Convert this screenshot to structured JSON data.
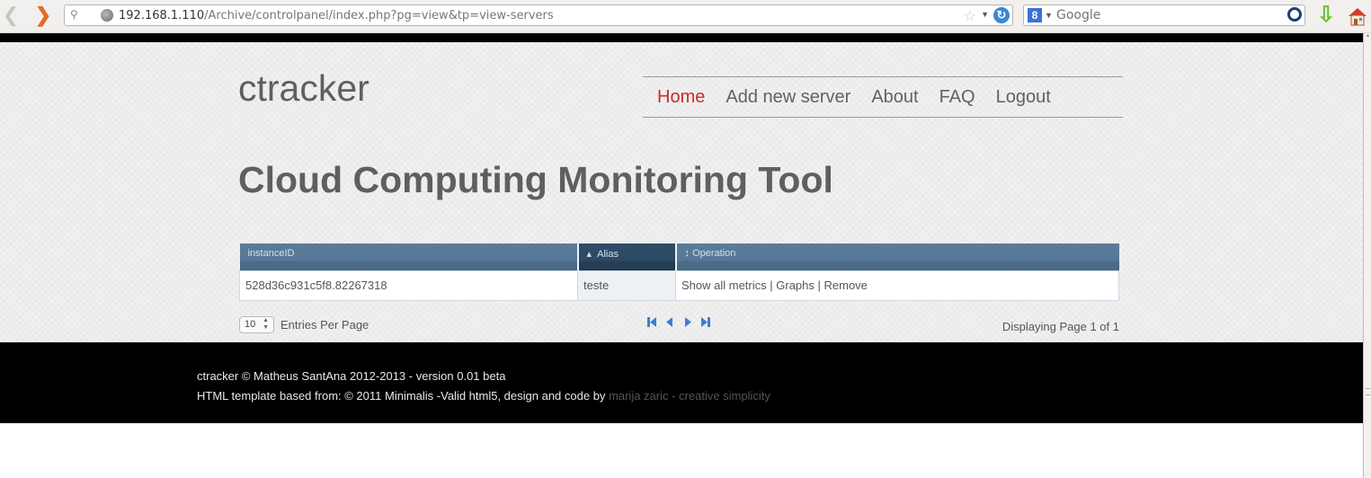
{
  "browser": {
    "url_host": "192.168.1.110",
    "url_path": "/Archive/controlpanel/index.php?pg=view&tp=view-servers",
    "search_placeholder": "Google"
  },
  "site": {
    "logo": "ctracker",
    "nav": [
      {
        "label": "Home",
        "active": true
      },
      {
        "label": "Add new server"
      },
      {
        "label": "About"
      },
      {
        "label": "FAQ"
      },
      {
        "label": "Logout"
      }
    ],
    "title": "Cloud Computing Monitoring Tool"
  },
  "table": {
    "columns": [
      {
        "label": "instanceID",
        "sort_icon": ""
      },
      {
        "label": "Alias",
        "sort_icon": "▴"
      },
      {
        "label": "Operation",
        "sort_icon": "↕"
      }
    ],
    "rows": [
      {
        "instanceID": "528d36c931c5f8.82267318",
        "alias": "teste",
        "operations": [
          "Show all metrics",
          "Graphs",
          "Remove"
        ]
      }
    ]
  },
  "pagination": {
    "per_page": "10",
    "per_page_label": "Entries Per Page",
    "info": "Displaying Page 1 of 1",
    "accent": "#3d7ed1"
  },
  "footer": {
    "line1": "ctracker © Matheus SantAna 2012-2013 - version 0.01 beta",
    "line2": "HTML template based from: © 2011 Minimalis -Valid html5, design and code by ",
    "credit_link": "marija zaric - creative simplicity"
  }
}
